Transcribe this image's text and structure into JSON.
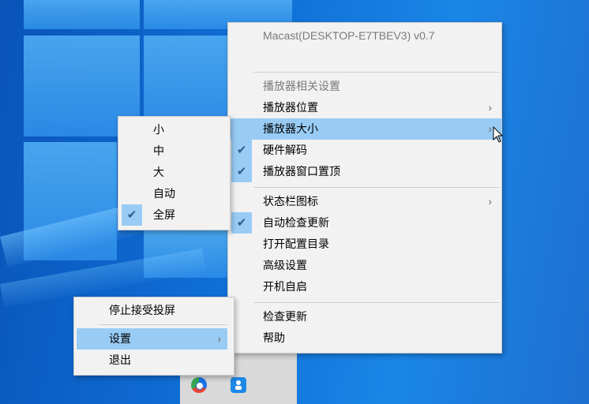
{
  "main_menu": {
    "title": "Macast(DESKTOP-E7TBEV3) v0.7",
    "section_header": "播放器相关设置",
    "items": [
      {
        "label": "播放器位置",
        "arrow": "›",
        "checked": false
      },
      {
        "label": "播放器大小",
        "arrow": "›",
        "checked": false,
        "highlighted": true
      },
      {
        "label": "硬件解码",
        "checked": true
      },
      {
        "label": "播放器窗口置顶",
        "checked": true
      },
      {
        "label": "状态栏图标",
        "arrow": "›",
        "checked": false
      },
      {
        "label": "自动检查更新",
        "checked": true
      },
      {
        "label": "打开配置目录",
        "checked": false
      },
      {
        "label": "高级设置",
        "checked": false
      },
      {
        "label": "开机自启",
        "checked": false
      },
      {
        "label": "检查更新",
        "checked": false
      },
      {
        "label": "帮助",
        "checked": false
      }
    ]
  },
  "size_submenu": {
    "items": [
      {
        "label": "小",
        "checked": false
      },
      {
        "label": "中",
        "checked": false
      },
      {
        "label": "大",
        "checked": false
      },
      {
        "label": "自动",
        "checked": false
      },
      {
        "label": "全屏",
        "checked": true
      }
    ]
  },
  "tray_menu": {
    "items": [
      {
        "label": "停止接受投屏"
      },
      {
        "label": "设置",
        "arrow": "›",
        "highlighted": true
      },
      {
        "label": "退出"
      }
    ]
  },
  "check_glyph": "✔",
  "colors": {
    "menu_bg": "#f2f2f2",
    "highlight": "#99ccf5",
    "desktop": "#0f6fd6",
    "check": "#2e5d8c"
  },
  "icons": [
    "chrome-like-browser-icon",
    "macast-speaker-icon",
    "mouse-cursor-icon"
  ]
}
